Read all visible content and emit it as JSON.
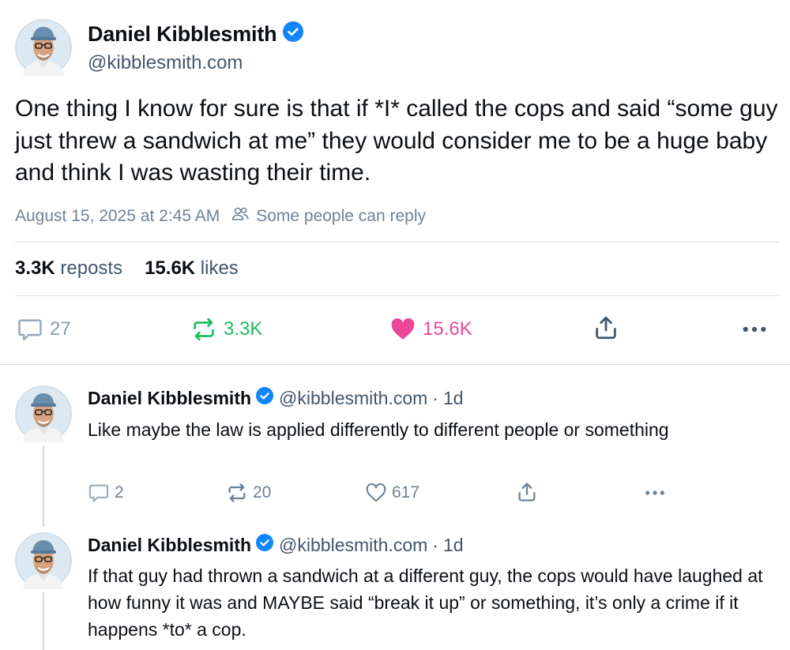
{
  "main_post": {
    "author_name": "Daniel Kibblesmith",
    "handle": "@kibblesmith.com",
    "text": "One thing I know for sure is that if *I* called the cops and said “some guy just threw a sandwich at me” they would consider me to be a huge baby and think I was wasting their time.",
    "timestamp": "August 15, 2025 at 2:45 AM",
    "reply_setting": "Some people can reply",
    "reposts_count": "3.3K",
    "reposts_label": "reposts",
    "likes_count": "15.6K",
    "likes_label": "likes",
    "actions": {
      "reply_count": "27",
      "repost_count": "3.3K",
      "like_count": "15.6K"
    }
  },
  "replies": [
    {
      "author_name": "Daniel Kibblesmith",
      "handle": "@kibblesmith.com",
      "separator": "·",
      "time": "1d",
      "text": "Like maybe the law is applied differently to different people or something",
      "reply_count": "2",
      "repost_count": "20",
      "like_count": "617"
    },
    {
      "author_name": "Daniel Kibblesmith",
      "handle": "@kibblesmith.com",
      "separator": "·",
      "time": "1d",
      "text": "If that guy had thrown a sandwich at a different guy, the cops would have laughed at how funny it was and MAYBE said “break it up” or something, it’s only a crime if it happens *to* a cop."
    }
  ],
  "icons": {
    "verified": "verified-badge-icon",
    "people": "people-icon",
    "reply": "comment-icon",
    "repost": "repost-icon",
    "like": "heart-icon",
    "share": "share-icon",
    "more": "more-icon"
  },
  "colors": {
    "verified_blue": "#1185fe",
    "repost_green": "#20bc65",
    "like_pink": "#ec4899",
    "muted_text": "#6f8294",
    "handle_text": "#42576c",
    "divider": "#d4dbe2"
  }
}
